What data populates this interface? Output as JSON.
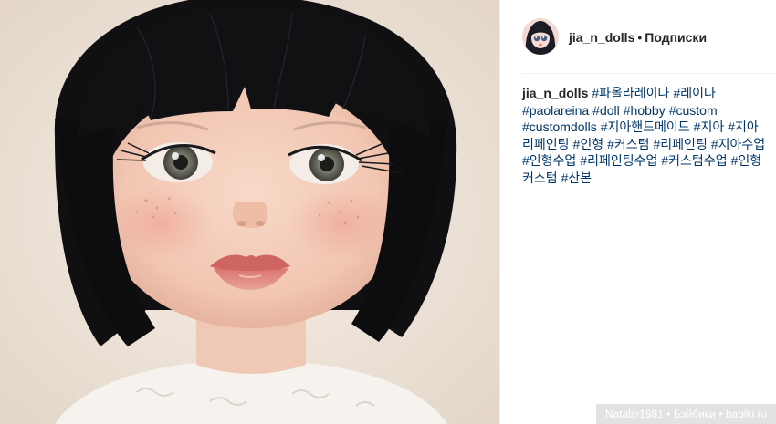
{
  "post": {
    "image_alt": "doll portrait"
  },
  "header": {
    "username": "jia_n_dolls",
    "separator": "•",
    "follow_label": "Подписки"
  },
  "caption": {
    "username": "jia_n_dolls",
    "lines": [
      [
        "#파올라레이나",
        "#레이나"
      ],
      [
        "#paolareina",
        "#doll",
        "#hobby",
        "#custom"
      ],
      [
        "#customdolls",
        "#지아핸드메이드",
        "#지아",
        "#지아"
      ],
      [
        "리페인팅",
        "#인형",
        "#커스텀",
        "#리페인팅",
        "#지아수업"
      ],
      [
        "#인형수업",
        "#리페인팅수업",
        "#커스텀수업",
        "#인형"
      ],
      [
        "커스텀",
        "#산본"
      ]
    ]
  },
  "watermark": {
    "text": "Natalie1981 • Бэйбики • babiki.ru"
  },
  "colors": {
    "hashtag": "#003569",
    "text": "#262626",
    "divider": "#efefef"
  }
}
